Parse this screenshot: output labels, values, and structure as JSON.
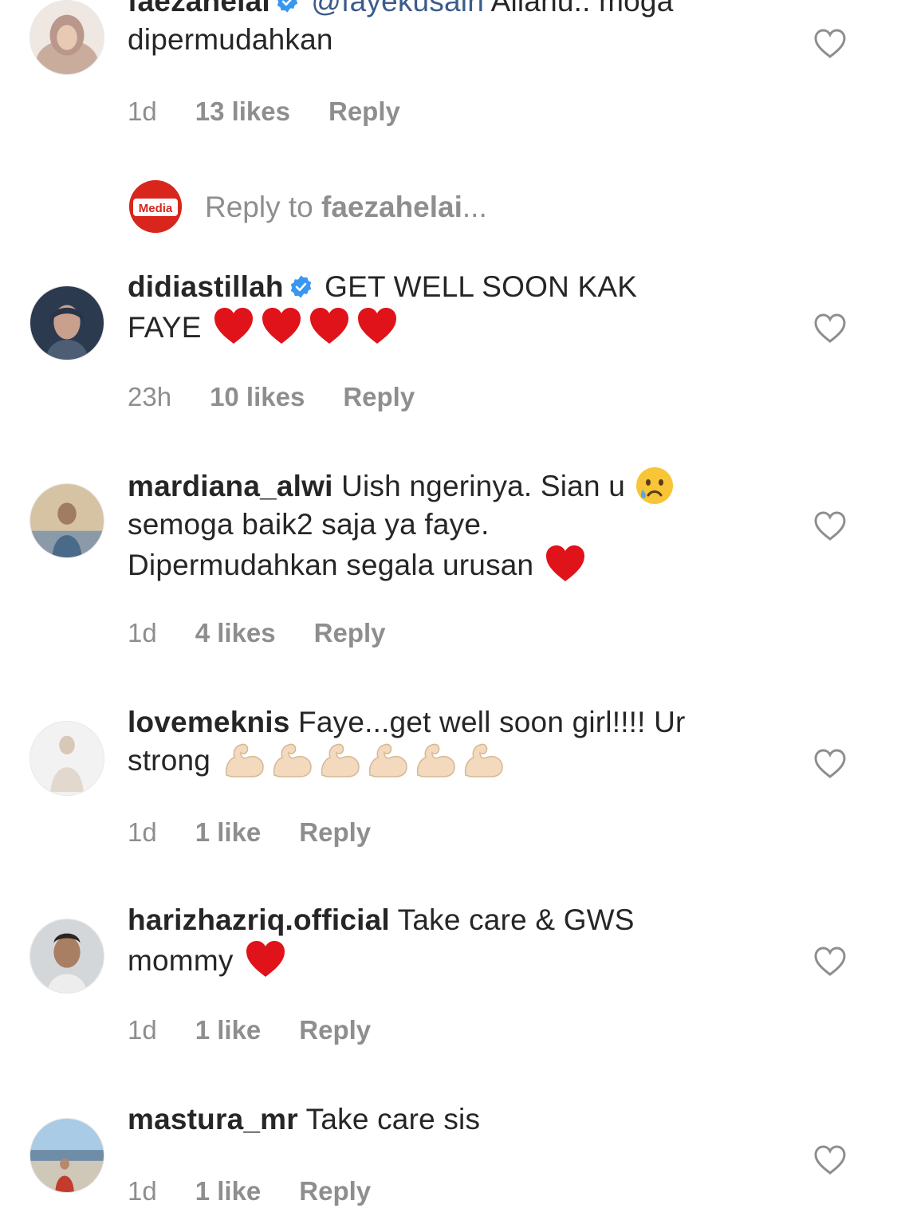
{
  "comments": [
    {
      "username": "faezahelai",
      "verified": true,
      "mention": "@fayekusairi",
      "text_line1": "Allahu.. moga",
      "text_line2": "dipermudahkan",
      "time": "1d",
      "likes": "13 likes",
      "reply": "Reply",
      "avatar_colors": [
        "#d9c2b3",
        "#b99c8c"
      ]
    },
    {
      "username": "didiastillah",
      "verified": true,
      "text_line1": "GET WELL SOON KAK",
      "text_line2": "FAYE",
      "emoji": "red-heart-emoji x4",
      "time": "23h",
      "likes": "10 likes",
      "reply": "Reply",
      "avatar_colors": [
        "#3d4f66",
        "#c49a86"
      ]
    },
    {
      "username": "mardiana_alwi",
      "verified": false,
      "text_line1": "Uish ngerinya. Sian u",
      "text_line2": "semoga baik2 saja ya faye.",
      "text_line3": "Dipermudahkan segala urusan",
      "emoji": "crying-face-emoji, red-heart-emoji",
      "time": "1d",
      "likes": "4 likes",
      "reply": "Reply",
      "avatar_colors": [
        "#c7b08f",
        "#4a6a8a"
      ]
    },
    {
      "username": "lovemeknis",
      "verified": false,
      "text_line1": "Faye...get well soon girl!!!! Ur",
      "text_line2": "strong",
      "emoji": "flexed-biceps-emoji x6",
      "time": "1d",
      "likes": "1 like",
      "reply": "Reply",
      "avatar_colors": [
        "#eeeeee",
        "#d8cfc6"
      ]
    },
    {
      "username": "harizhazriq.official",
      "verified": false,
      "text_line1": "Take care & GWS",
      "text_line2": "mommy",
      "emoji": "red-heart-emoji",
      "time": "1d",
      "likes": "1 like",
      "reply": "Reply",
      "avatar_colors": [
        "#cfd3d6",
        "#7b6a5c"
      ]
    },
    {
      "username": "mastura_mr",
      "verified": false,
      "text_line1": "Take care sis",
      "time": "1d",
      "likes": "1 like",
      "reply": "Reply",
      "avatar_colors": [
        "#9fc3e0",
        "#c23b2c"
      ]
    }
  ],
  "reply_box": {
    "prefix": "Reply to",
    "target": "faezahelai",
    "suffix": "...",
    "avatar_brand_text": "Media",
    "avatar_color": "#d9261c"
  },
  "colors": {
    "text": "#262626",
    "muted": "#8e8e8e",
    "mention": "#3b5b8c",
    "verified": "#3897f0",
    "heart_red": "#e0131a"
  }
}
